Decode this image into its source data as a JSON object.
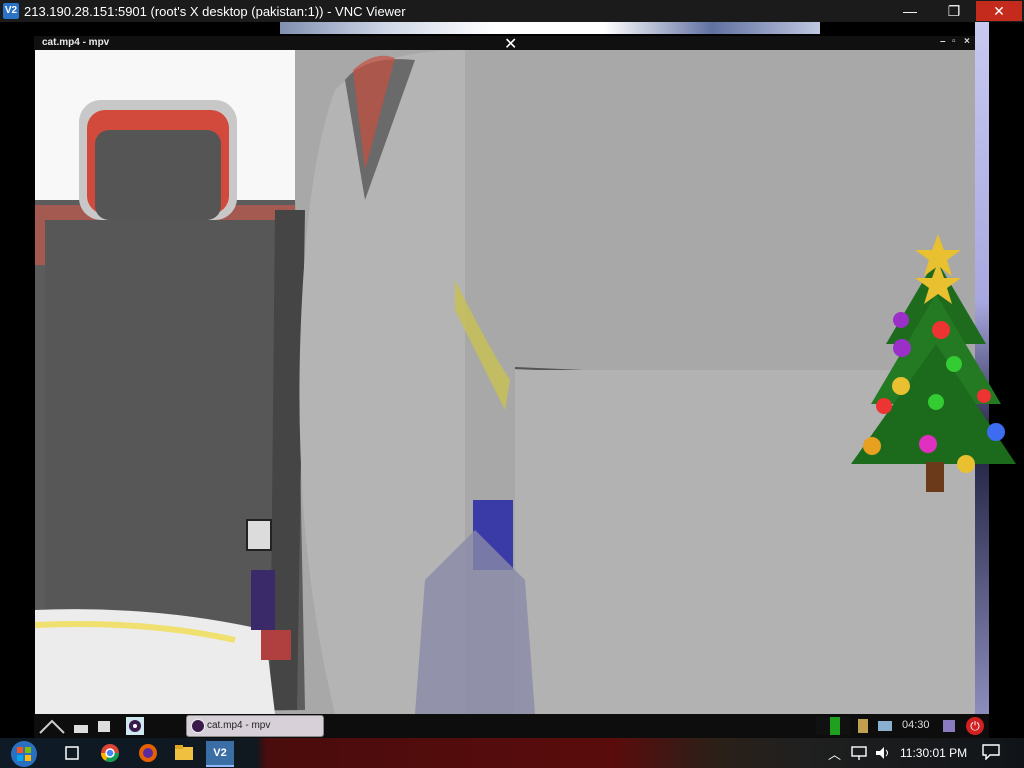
{
  "vnc": {
    "title": "213.190.28.151:5901 (root's X desktop (pakistan:1)) - VNC Viewer",
    "logo": "V2",
    "controls": {
      "minimize": "—",
      "maximize": "❐",
      "close": "✕"
    }
  },
  "mpv": {
    "title": "cat.mp4 - mpv",
    "controls": {
      "minimize": "–",
      "maximize": "▫",
      "close": "×"
    },
    "drag_cursor": "✕"
  },
  "remote_panel": {
    "task_label": "cat.mp4 - mpv",
    "clock": "04:30",
    "icons": [
      "menu-icon",
      "terminal-icon",
      "window-list-icon",
      "media-player-icon"
    ],
    "tray_icons": [
      "cpu-graph-icon",
      "battery-icon",
      "network-icon",
      "user-icon",
      "power-icon"
    ]
  },
  "host_taskbar": {
    "clock": "11:30:01 PM",
    "pinned": [
      "start-orb-icon",
      "task-view-icon",
      "chrome-icon",
      "firefox-icon",
      "file-explorer-icon",
      "vnc-viewer-icon"
    ],
    "vnc_label": "V2",
    "tray": [
      "chevron-up-icon",
      "network-icon",
      "volume-icon"
    ]
  },
  "colors": {
    "vnc_titlebar": "#1b1b1b",
    "close_red": "#c42b1c",
    "video_gray": "#a9a9a9",
    "panel_dark": "#0d0d0d"
  }
}
